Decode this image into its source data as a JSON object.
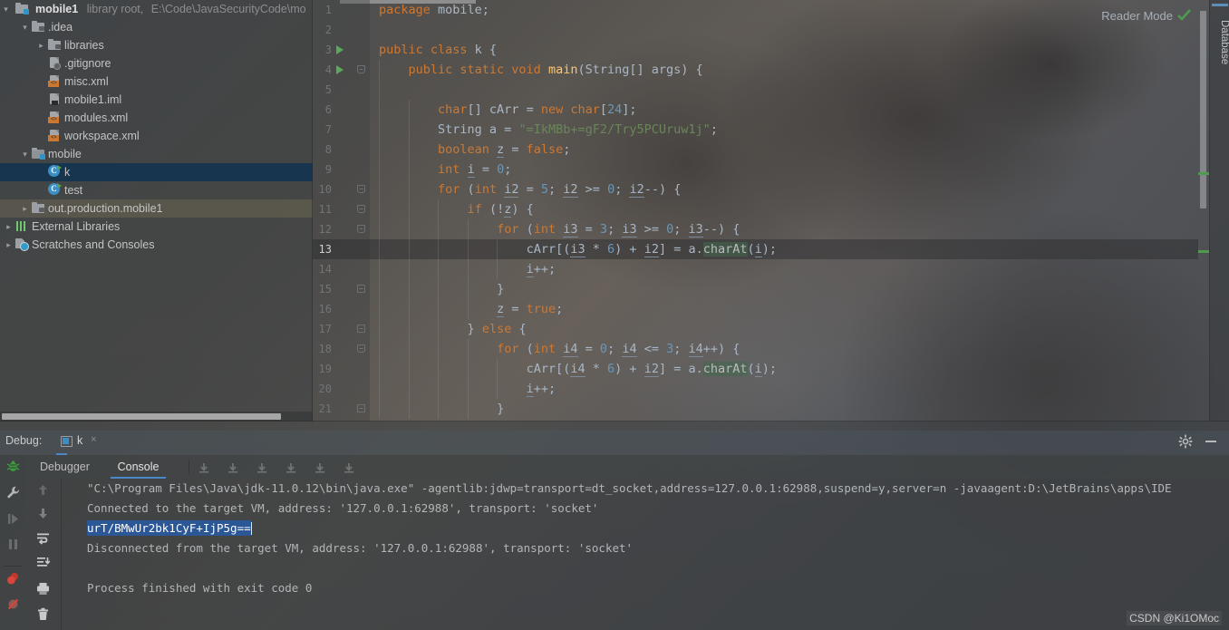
{
  "project": {
    "root_label": "mobile1",
    "root_meta": "library root,",
    "root_path": "E:\\Code\\JavaSecurityCode\\mo",
    "items": [
      {
        "label": ".idea",
        "icon": "folder-icon",
        "depth": 1,
        "twisty": "open",
        "state": "normal"
      },
      {
        "label": "libraries",
        "icon": "folder-icon",
        "depth": 2,
        "twisty": "closed",
        "state": "normal"
      },
      {
        "label": ".gitignore",
        "icon": "gitignore-file-icon",
        "depth": 2,
        "twisty": "blank",
        "state": "normal"
      },
      {
        "label": "misc.xml",
        "icon": "xml-file-icon",
        "depth": 2,
        "twisty": "blank",
        "state": "normal"
      },
      {
        "label": "mobile1.iml",
        "icon": "iml-file-icon",
        "depth": 2,
        "twisty": "blank",
        "state": "normal"
      },
      {
        "label": "modules.xml",
        "icon": "xml-file-icon",
        "depth": 2,
        "twisty": "blank",
        "state": "normal"
      },
      {
        "label": "workspace.xml",
        "icon": "xml-file-icon",
        "depth": 2,
        "twisty": "blank",
        "state": "normal"
      },
      {
        "label": "mobile",
        "icon": "module-folder-icon",
        "depth": 1,
        "twisty": "open",
        "state": "normal"
      },
      {
        "label": "k",
        "icon": "java-class-icon",
        "depth": 2,
        "twisty": "blank",
        "state": "selected"
      },
      {
        "label": "test",
        "icon": "java-class-icon",
        "depth": 2,
        "twisty": "blank",
        "state": "normal"
      },
      {
        "label": "out.production.mobile1",
        "icon": "folder-icon",
        "depth": 1,
        "twisty": "closed",
        "state": "tinted"
      },
      {
        "label": "External Libraries",
        "icon": "libraries-icon",
        "depth": 0,
        "twisty": "closed",
        "state": "normal"
      },
      {
        "label": "Scratches and Consoles",
        "icon": "scratches-icon",
        "depth": 0,
        "twisty": "closed",
        "state": "normal"
      }
    ]
  },
  "editor": {
    "reader_mode_label": "Reader Mode",
    "reader_mode_checked": true,
    "current_line": 13,
    "run_arrow_lines": [
      3,
      4
    ],
    "lines": [
      {
        "n": 1,
        "indent": 0,
        "fold": null,
        "tokens": [
          {
            "t": "kw",
            "v": "package"
          },
          {
            "t": "pln",
            "v": " mobile;"
          }
        ]
      },
      {
        "n": 2,
        "indent": 0,
        "fold": null,
        "tokens": []
      },
      {
        "n": 3,
        "indent": 0,
        "fold": null,
        "tokens": [
          {
            "t": "kw",
            "v": "public class"
          },
          {
            "t": "pln",
            "v": " k {"
          }
        ]
      },
      {
        "n": 4,
        "indent": 1,
        "fold": "pt",
        "tokens": [
          {
            "t": "kw",
            "v": "public static void"
          },
          {
            "t": "fn",
            "v": " main"
          },
          {
            "t": "pln",
            "v": "(String[] args) {"
          }
        ]
      },
      {
        "n": 5,
        "indent": 1,
        "fold": null,
        "tokens": []
      },
      {
        "n": 6,
        "indent": 2,
        "fold": null,
        "tokens": [
          {
            "t": "kw",
            "v": "char"
          },
          {
            "t": "pln",
            "v": "[] cArr = "
          },
          {
            "t": "kw",
            "v": "new"
          },
          {
            "t": "pln",
            "v": " "
          },
          {
            "t": "kw",
            "v": "char"
          },
          {
            "t": "pln",
            "v": "["
          },
          {
            "t": "num",
            "v": "24"
          },
          {
            "t": "pln",
            "v": "];"
          }
        ]
      },
      {
        "n": 7,
        "indent": 2,
        "fold": null,
        "tokens": [
          {
            "t": "pln",
            "v": "String a = "
          },
          {
            "t": "str",
            "v": "\"=IkMBb+=gF2/Try5PCUruw1j\""
          },
          {
            "t": "pln",
            "v": ";"
          }
        ]
      },
      {
        "n": 8,
        "indent": 2,
        "fold": null,
        "tokens": [
          {
            "t": "kw",
            "v": "boolean"
          },
          {
            "t": "pln",
            "v": " "
          },
          {
            "t": "var",
            "v": "z"
          },
          {
            "t": "pln",
            "v": " = "
          },
          {
            "t": "kw",
            "v": "false"
          },
          {
            "t": "pln",
            "v": ";"
          }
        ]
      },
      {
        "n": 9,
        "indent": 2,
        "fold": null,
        "tokens": [
          {
            "t": "kw",
            "v": "int"
          },
          {
            "t": "pln",
            "v": " "
          },
          {
            "t": "var",
            "v": "i"
          },
          {
            "t": "pln",
            "v": " = "
          },
          {
            "t": "num",
            "v": "0"
          },
          {
            "t": "pln",
            "v": ";"
          }
        ]
      },
      {
        "n": 10,
        "indent": 2,
        "fold": "pt",
        "tokens": [
          {
            "t": "kw",
            "v": "for"
          },
          {
            "t": "pln",
            "v": " ("
          },
          {
            "t": "kw",
            "v": "int"
          },
          {
            "t": "pln",
            "v": " "
          },
          {
            "t": "var",
            "v": "i2"
          },
          {
            "t": "pln",
            "v": " = "
          },
          {
            "t": "num",
            "v": "5"
          },
          {
            "t": "pln",
            "v": "; "
          },
          {
            "t": "var",
            "v": "i2"
          },
          {
            "t": "pln",
            "v": " >= "
          },
          {
            "t": "num",
            "v": "0"
          },
          {
            "t": "pln",
            "v": "; "
          },
          {
            "t": "var",
            "v": "i2"
          },
          {
            "t": "pln",
            "v": "--) {"
          }
        ]
      },
      {
        "n": 11,
        "indent": 3,
        "fold": "pt",
        "tokens": [
          {
            "t": "kw",
            "v": "if"
          },
          {
            "t": "pln",
            "v": " (!"
          },
          {
            "t": "var",
            "v": "z"
          },
          {
            "t": "pln",
            "v": ") {"
          }
        ]
      },
      {
        "n": 12,
        "indent": 4,
        "fold": "pt",
        "tokens": [
          {
            "t": "kw",
            "v": "for"
          },
          {
            "t": "pln",
            "v": " ("
          },
          {
            "t": "kw",
            "v": "int"
          },
          {
            "t": "pln",
            "v": " "
          },
          {
            "t": "var",
            "v": "i3"
          },
          {
            "t": "pln",
            "v": " = "
          },
          {
            "t": "num",
            "v": "3"
          },
          {
            "t": "pln",
            "v": "; "
          },
          {
            "t": "var",
            "v": "i3"
          },
          {
            "t": "pln",
            "v": " >= "
          },
          {
            "t": "num",
            "v": "0"
          },
          {
            "t": "pln",
            "v": "; "
          },
          {
            "t": "var",
            "v": "i3"
          },
          {
            "t": "pln",
            "v": "--) {"
          }
        ]
      },
      {
        "n": 13,
        "indent": 5,
        "fold": null,
        "tokens": [
          {
            "t": "pln",
            "v": "cArr[("
          },
          {
            "t": "var",
            "v": "i3"
          },
          {
            "t": "pln",
            "v": " * "
          },
          {
            "t": "num",
            "v": "6"
          },
          {
            "t": "pln",
            "v": ") + "
          },
          {
            "t": "var",
            "v": "i2"
          },
          {
            "t": "pln",
            "v": "] = a."
          },
          {
            "t": "hl",
            "v": "charAt"
          },
          {
            "t": "pln",
            "v": "("
          },
          {
            "t": "var",
            "v": "i"
          },
          {
            "t": "pln",
            "v": ");"
          }
        ]
      },
      {
        "n": 14,
        "indent": 5,
        "fold": null,
        "tokens": [
          {
            "t": "var",
            "v": "i"
          },
          {
            "t": "pln",
            "v": "++;"
          }
        ]
      },
      {
        "n": 15,
        "indent": 4,
        "fold": "sq",
        "tokens": [
          {
            "t": "pln",
            "v": "}"
          }
        ]
      },
      {
        "n": 16,
        "indent": 4,
        "fold": null,
        "tokens": [
          {
            "t": "var",
            "v": "z"
          },
          {
            "t": "pln",
            "v": " = "
          },
          {
            "t": "kw",
            "v": "true"
          },
          {
            "t": "pln",
            "v": ";"
          }
        ]
      },
      {
        "n": 17,
        "indent": 3,
        "fold": "sq",
        "tokens": [
          {
            "t": "pln",
            "v": "} "
          },
          {
            "t": "kw",
            "v": "else"
          },
          {
            "t": "pln",
            "v": " {"
          }
        ]
      },
      {
        "n": 18,
        "indent": 4,
        "fold": "pt",
        "tokens": [
          {
            "t": "kw",
            "v": "for"
          },
          {
            "t": "pln",
            "v": " ("
          },
          {
            "t": "kw",
            "v": "int"
          },
          {
            "t": "pln",
            "v": " "
          },
          {
            "t": "var",
            "v": "i4"
          },
          {
            "t": "pln",
            "v": " = "
          },
          {
            "t": "num",
            "v": "0"
          },
          {
            "t": "pln",
            "v": "; "
          },
          {
            "t": "var",
            "v": "i4"
          },
          {
            "t": "pln",
            "v": " <= "
          },
          {
            "t": "num",
            "v": "3"
          },
          {
            "t": "pln",
            "v": "; "
          },
          {
            "t": "var",
            "v": "i4"
          },
          {
            "t": "pln",
            "v": "++) {"
          }
        ]
      },
      {
        "n": 19,
        "indent": 5,
        "fold": null,
        "tokens": [
          {
            "t": "pln",
            "v": "cArr[("
          },
          {
            "t": "var",
            "v": "i4"
          },
          {
            "t": "pln",
            "v": " * "
          },
          {
            "t": "num",
            "v": "6"
          },
          {
            "t": "pln",
            "v": ") + "
          },
          {
            "t": "var",
            "v": "i2"
          },
          {
            "t": "pln",
            "v": "] = a."
          },
          {
            "t": "hl",
            "v": "charAt"
          },
          {
            "t": "pln",
            "v": "("
          },
          {
            "t": "var",
            "v": "i"
          },
          {
            "t": "pln",
            "v": ");"
          }
        ]
      },
      {
        "n": 20,
        "indent": 5,
        "fold": null,
        "tokens": [
          {
            "t": "var",
            "v": "i"
          },
          {
            "t": "pln",
            "v": "++;"
          }
        ]
      },
      {
        "n": 21,
        "indent": 4,
        "fold": "sq",
        "tokens": [
          {
            "t": "pln",
            "v": "}"
          }
        ]
      }
    ]
  },
  "right_bar": {
    "database_label": "Database"
  },
  "debug": {
    "panel_label": "Debug:",
    "session_tab": "k",
    "close_glyph": "×",
    "tabs": [
      {
        "label": "Debugger",
        "active": false
      },
      {
        "label": "Console",
        "active": true
      }
    ],
    "left_icons": [
      "bug-icon",
      "wrench-icon",
      "resume-icon",
      "pause-icon",
      "breakpoints-icon",
      "mute-breakpoints-icon"
    ],
    "console_gutter_icons": [
      "scroll-up-icon",
      "scroll-down-icon",
      "soft-wrap-icon",
      "scroll-to-end-icon",
      "print-icon",
      "clear-all-icon"
    ],
    "console_lines": [
      {
        "text": "\"C:\\Program Files\\Java\\jdk-11.0.12\\bin\\java.exe\" -agentlib:jdwp=transport=dt_socket,address=127.0.0.1:62988,suspend=y,server=n -javaagent:D:\\JetBrains\\apps\\IDE",
        "selected": false
      },
      {
        "text": "Connected to the target VM, address: '127.0.0.1:62988', transport: 'socket'",
        "selected": false
      },
      {
        "text": "urT/BMwUr2bk1CyF+IjP5g==",
        "selected": true
      },
      {
        "text": "Disconnected from the target VM, address: '127.0.0.1:62988', transport: 'socket'",
        "selected": false
      },
      {
        "text": "",
        "selected": false
      },
      {
        "text": "Process finished with exit code 0",
        "selected": false
      }
    ]
  },
  "watermark": "CSDN @Ki1OMoc",
  "colors": {
    "accent_blue": "#4a88c7",
    "selection_row": "#143450",
    "console_selection": "#2b5797",
    "keyword_orange": "#cc7832",
    "string_green": "#6a8759",
    "number_blue": "#6897bb",
    "method_yellow": "#ffc66d",
    "plain_text": "#a9b7c6",
    "run_arrow_green": "#5aa85a"
  }
}
